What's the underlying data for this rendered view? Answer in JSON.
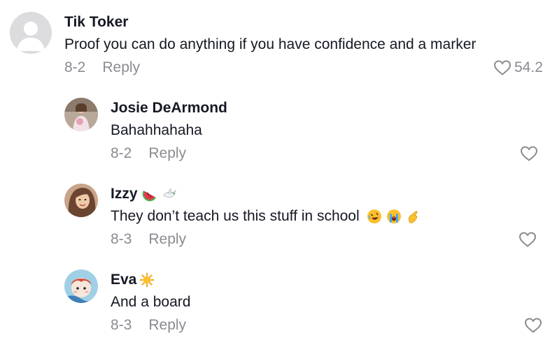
{
  "comments": [
    {
      "author": "Tik Toker",
      "text": "Proof you can do anything if you have confidence and a marker",
      "date": "8-2",
      "reply_label": "Reply",
      "likes": "54.2",
      "avatar_icon": "default-avatar-icon"
    },
    {
      "author": "Josie DeArmond",
      "text": "Bahahhahaha",
      "date": "8-2",
      "reply_label": "Reply",
      "avatar_icon": "photo-avatar"
    },
    {
      "author": "Izzy",
      "author_emojis": [
        "watermelon-emoji",
        "dove-emoji"
      ],
      "text": "They don’t teach us this stuff in school",
      "text_emojis": [
        "rolling-laughing-emoji",
        "crying-emoji",
        "pinching-hand-emoji"
      ],
      "date": "8-3",
      "reply_label": "Reply",
      "avatar_icon": "photo-avatar"
    },
    {
      "author": "Eva",
      "author_emojis": [
        "sun-emoji"
      ],
      "text": "And a board",
      "date": "8-3",
      "reply_label": "Reply",
      "avatar_icon": "cartoon-avatar"
    }
  ],
  "colors": {
    "text": "#161823",
    "secondary": "#8a8b91",
    "default_avatar_bg": "#d9d9db"
  }
}
